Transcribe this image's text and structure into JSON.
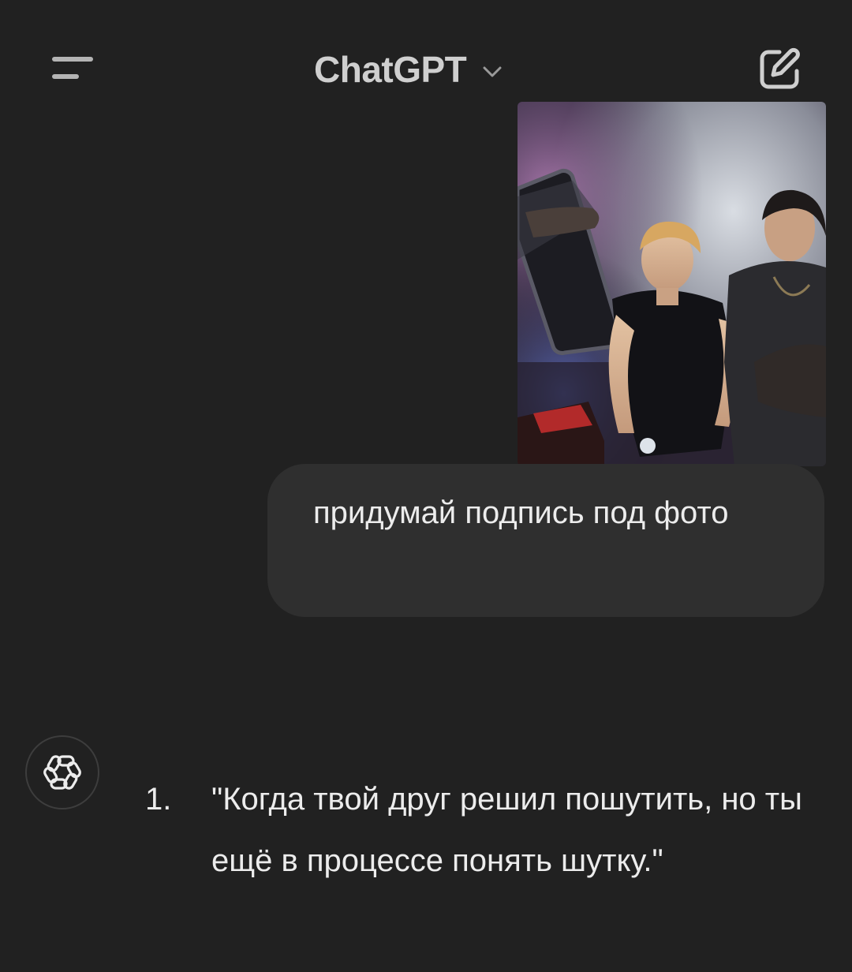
{
  "header": {
    "title": "ChatGPT",
    "menu_icon": "hamburger-menu-icon",
    "switcher_icon": "chevron-down-icon",
    "new_chat_icon": "compose-icon"
  },
  "conversation": {
    "user_message": {
      "text": "придумай подпись под фото",
      "attachment": "photo"
    },
    "assistant_message": {
      "avatar_icon": "openai-logo-icon",
      "items": [
        {
          "number": "1.",
          "text": "\"Когда твой друг решил пошутить, но ты ещё в процессе понять шутку.\""
        }
      ]
    }
  },
  "colors": {
    "background": "#212121",
    "bubble": "#2f2f2f",
    "text": "#ececec",
    "icon": "#b4b4b4"
  }
}
